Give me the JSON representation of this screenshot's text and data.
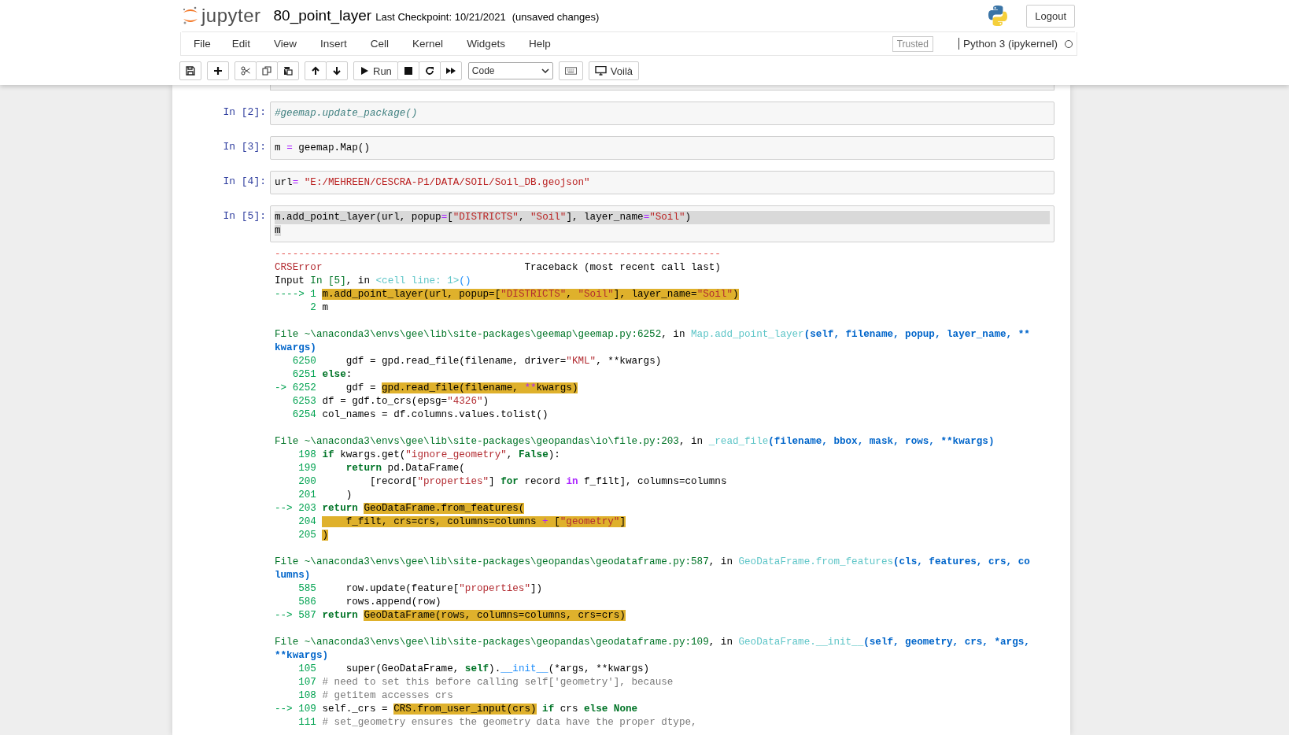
{
  "header": {
    "logo_text": "jupyter",
    "notebook_name": "80_point_layer",
    "checkpoint": "Last Checkpoint: 10/21/2021",
    "autosave_status": "(unsaved changes)",
    "logout_button": "Logout"
  },
  "menubar": {
    "items": [
      "File",
      "Edit",
      "View",
      "Insert",
      "Cell",
      "Kernel",
      "Widgets",
      "Help"
    ],
    "trusted_badge": "Trusted",
    "kernel_name": "Python 3 (ipykernel)",
    "kernel_busy": false
  },
  "toolbar": {
    "groups": [
      [
        {
          "kind": "save"
        }
      ],
      [
        {
          "kind": "insert"
        }
      ],
      [
        {
          "kind": "cut"
        },
        {
          "kind": "copy"
        },
        {
          "kind": "paste"
        }
      ],
      [
        {
          "kind": "move-up"
        },
        {
          "kind": "move-down"
        }
      ],
      [
        {
          "kind": "run",
          "label": "Run"
        },
        {
          "kind": "stop"
        },
        {
          "kind": "restart"
        },
        {
          "kind": "run-all"
        }
      ]
    ],
    "cell_type": "Code",
    "extra": [
      {
        "kind": "keyboard"
      },
      {
        "kind": "voila",
        "label": "Voilà"
      }
    ]
  },
  "cells": [
    {
      "prompt": "In [2]:",
      "lines": [
        {
          "selected": false,
          "tokens": [
            {
              "kind": "comment",
              "text": "#geemap.update_package()"
            }
          ]
        }
      ]
    },
    {
      "prompt": "In [3]:",
      "lines": [
        {
          "selected": false,
          "tokens": [
            {
              "kind": "plain",
              "text": "m "
            },
            {
              "kind": "operator",
              "text": "="
            },
            {
              "kind": "plain",
              "text": " geemap.Map()"
            }
          ]
        }
      ]
    },
    {
      "prompt": "In [4]:",
      "lines": [
        {
          "selected": false,
          "tokens": [
            {
              "kind": "plain",
              "text": "url"
            },
            {
              "kind": "operator",
              "text": "= "
            },
            {
              "kind": "string",
              "text": "\"E:/MEHREEN/CESCRA-P1/DATA/SOIL/Soil_DB.geojson\""
            }
          ]
        }
      ]
    },
    {
      "prompt": "In [5]:",
      "lines": [
        {
          "selected": true,
          "tokens": [
            {
              "kind": "plain",
              "text": "m.add_point_layer(url, popup"
            },
            {
              "kind": "operator",
              "text": "="
            },
            {
              "kind": "plain",
              "text": "["
            },
            {
              "kind": "string",
              "text": "\"DISTRICTS\""
            },
            {
              "kind": "plain",
              "text": ", "
            },
            {
              "kind": "string",
              "text": "\"Soil\""
            },
            {
              "kind": "plain",
              "text": "], layer_name"
            },
            {
              "kind": "operator",
              "text": "="
            },
            {
              "kind": "string",
              "text": "\"Soil\""
            },
            {
              "kind": "plain",
              "text": ")"
            }
          ]
        },
        {
          "selected": true,
          "tokens": [
            {
              "kind": "plain",
              "text": "m"
            }
          ]
        }
      ],
      "output": [
        {
          "gap_before": false,
          "tokens": [
            {
              "kind": "dash",
              "text": "---------------------------------------------------------------------------"
            }
          ]
        },
        {
          "gap_before": false,
          "tokens": [
            {
              "kind": "error",
              "text": "CRSError"
            },
            {
              "kind": "plain",
              "text": "                                  Traceback (most recent call last)"
            }
          ]
        },
        {
          "gap_before": false,
          "tokens": [
            {
              "kind": "plain",
              "text": "Input "
            },
            {
              "kind": "path",
              "text": "In [5]"
            },
            {
              "kind": "plain",
              "text": ", in "
            },
            {
              "kind": "func",
              "text": "<cell line: 1>"
            },
            {
              "kind": "call",
              "text": "()"
            }
          ]
        },
        {
          "gap_before": false,
          "tokens": [
            {
              "kind": "arrow",
              "text": "----> 1 "
            },
            {
              "kind": "mark",
              "text": "m.add_point_layer(url, popup=["
            },
            {
              "kind": "mark-string",
              "text": "\"DISTRICTS\""
            },
            {
              "kind": "mark",
              "text": ", "
            },
            {
              "kind": "mark-string",
              "text": "\"Soil\""
            },
            {
              "kind": "mark",
              "text": "], layer_name="
            },
            {
              "kind": "mark-string",
              "text": "\"Soil\""
            },
            {
              "kind": "mark",
              "text": ")"
            }
          ]
        },
        {
          "gap_before": false,
          "tokens": [
            {
              "kind": "lineno",
              "text": "      2 "
            },
            {
              "kind": "plain",
              "text": "m"
            }
          ]
        },
        {
          "gap_before": true,
          "tokens": [
            {
              "kind": "path",
              "text": "File ~\\anaconda3\\envs\\gee\\lib\\site-packages\\geemap\\geemap.py:6252"
            },
            {
              "kind": "plain",
              "text": ", in "
            },
            {
              "kind": "func",
              "text": "Map.add_point_layer"
            },
            {
              "kind": "args",
              "text": "(self, filename, popup, layer_name, **"
            }
          ]
        },
        {
          "gap_before": false,
          "tokens": [
            {
              "kind": "args",
              "text": "kwargs)"
            }
          ]
        },
        {
          "gap_before": false,
          "tokens": [
            {
              "kind": "lineno",
              "text": "   6250 "
            },
            {
              "kind": "plain",
              "text": "    gdf = gpd.read_file(filename, driver="
            },
            {
              "kind": "string",
              "text": "\"KML\""
            },
            {
              "kind": "plain",
              "text": ", **kwargs)"
            }
          ]
        },
        {
          "gap_before": false,
          "tokens": [
            {
              "kind": "lineno",
              "text": "   6251 "
            },
            {
              "kind": "keyword",
              "text": "else"
            },
            {
              "kind": "plain",
              "text": ":"
            }
          ]
        },
        {
          "gap_before": false,
          "tokens": [
            {
              "kind": "arrow",
              "text": "-> 6252 "
            },
            {
              "kind": "plain",
              "text": "    gdf = "
            },
            {
              "kind": "mark",
              "text": "gpd.read_file(filename, "
            },
            {
              "kind": "mark-operator",
              "text": "**"
            },
            {
              "kind": "mark",
              "text": "kwargs)"
            }
          ]
        },
        {
          "gap_before": false,
          "tokens": [
            {
              "kind": "lineno",
              "text": "   6253 "
            },
            {
              "kind": "plain",
              "text": "df = gdf.to_crs(epsg="
            },
            {
              "kind": "string",
              "text": "\"4326\""
            },
            {
              "kind": "plain",
              "text": ")"
            }
          ]
        },
        {
          "gap_before": false,
          "tokens": [
            {
              "kind": "lineno",
              "text": "   6254 "
            },
            {
              "kind": "plain",
              "text": "col_names = df.columns.values.tolist()"
            }
          ]
        },
        {
          "gap_before": true,
          "tokens": [
            {
              "kind": "path",
              "text": "File ~\\anaconda3\\envs\\gee\\lib\\site-packages\\geopandas\\io\\file.py:203"
            },
            {
              "kind": "plain",
              "text": ", in "
            },
            {
              "kind": "func",
              "text": "_read_file"
            },
            {
              "kind": "args",
              "text": "(filename, bbox, mask, rows, **kwargs)"
            }
          ]
        },
        {
          "gap_before": false,
          "tokens": [
            {
              "kind": "lineno",
              "text": "    198 "
            },
            {
              "kind": "keyword",
              "text": "if"
            },
            {
              "kind": "plain",
              "text": " kwargs.get("
            },
            {
              "kind": "string",
              "text": "\"ignore_geometry\""
            },
            {
              "kind": "plain",
              "text": ", "
            },
            {
              "kind": "keyword",
              "text": "False"
            },
            {
              "kind": "plain",
              "text": "):"
            }
          ]
        },
        {
          "gap_before": false,
          "tokens": [
            {
              "kind": "lineno",
              "text": "    199     "
            },
            {
              "kind": "keyword",
              "text": "return"
            },
            {
              "kind": "plain",
              "text": " pd.DataFrame("
            }
          ]
        },
        {
          "gap_before": false,
          "tokens": [
            {
              "kind": "lineno",
              "text": "    200 "
            },
            {
              "kind": "plain",
              "text": "        [record["
            },
            {
              "kind": "string",
              "text": "\"properties\""
            },
            {
              "kind": "plain",
              "text": "] "
            },
            {
              "kind": "keyword",
              "text": "for"
            },
            {
              "kind": "plain",
              "text": " record "
            },
            {
              "kind": "operator",
              "text": "in"
            },
            {
              "kind": "plain",
              "text": " f_filt], columns=columns"
            }
          ]
        },
        {
          "gap_before": false,
          "tokens": [
            {
              "kind": "lineno",
              "text": "    201 "
            },
            {
              "kind": "plain",
              "text": "    )"
            }
          ]
        },
        {
          "gap_before": false,
          "tokens": [
            {
              "kind": "arrow",
              "text": "--> 203 "
            },
            {
              "kind": "keyword",
              "text": "return "
            },
            {
              "kind": "mark",
              "text": "GeoDataFrame.from_features("
            }
          ]
        },
        {
          "gap_before": false,
          "tokens": [
            {
              "kind": "lineno",
              "text": "    204 "
            },
            {
              "kind": "mark",
              "text": "    f_filt, crs=crs, columns=columns "
            },
            {
              "kind": "mark-operator",
              "text": "+"
            },
            {
              "kind": "mark",
              "text": " ["
            },
            {
              "kind": "mark-string",
              "text": "\"geometry\""
            },
            {
              "kind": "mark",
              "text": "]"
            }
          ]
        },
        {
          "gap_before": false,
          "tokens": [
            {
              "kind": "lineno",
              "text": "    205 "
            },
            {
              "kind": "mark",
              "text": ")"
            }
          ]
        },
        {
          "gap_before": true,
          "tokens": [
            {
              "kind": "path",
              "text": "File ~\\anaconda3\\envs\\gee\\lib\\site-packages\\geopandas\\geodataframe.py:587"
            },
            {
              "kind": "plain",
              "text": ", in "
            },
            {
              "kind": "func",
              "text": "GeoDataFrame.from_features"
            },
            {
              "kind": "args",
              "text": "(cls, features, crs, co"
            }
          ]
        },
        {
          "gap_before": false,
          "tokens": [
            {
              "kind": "args",
              "text": "lumns)"
            }
          ]
        },
        {
          "gap_before": false,
          "tokens": [
            {
              "kind": "lineno",
              "text": "    585 "
            },
            {
              "kind": "plain",
              "text": "    row.update(feature["
            },
            {
              "kind": "string",
              "text": "\"properties\""
            },
            {
              "kind": "plain",
              "text": "])"
            }
          ]
        },
        {
          "gap_before": false,
          "tokens": [
            {
              "kind": "lineno",
              "text": "    586 "
            },
            {
              "kind": "plain",
              "text": "    rows.append(row)"
            }
          ]
        },
        {
          "gap_before": false,
          "tokens": [
            {
              "kind": "arrow",
              "text": "--> 587 "
            },
            {
              "kind": "keyword",
              "text": "return "
            },
            {
              "kind": "mark",
              "text": "GeoDataFrame(rows, columns=columns, crs=crs)"
            }
          ]
        },
        {
          "gap_before": true,
          "tokens": [
            {
              "kind": "path",
              "text": "File ~\\anaconda3\\envs\\gee\\lib\\site-packages\\geopandas\\geodataframe.py:109"
            },
            {
              "kind": "plain",
              "text": ", in "
            },
            {
              "kind": "func",
              "text": "GeoDataFrame.__init__"
            },
            {
              "kind": "args",
              "text": "(self, geometry, crs, *args,"
            }
          ]
        },
        {
          "gap_before": false,
          "tokens": [
            {
              "kind": "args",
              "text": "**kwargs)"
            }
          ]
        },
        {
          "gap_before": false,
          "tokens": [
            {
              "kind": "lineno",
              "text": "    105 "
            },
            {
              "kind": "plain",
              "text": "    super(GeoDataFrame, "
            },
            {
              "kind": "keyword",
              "text": "self"
            },
            {
              "kind": "plain",
              "text": ")."
            },
            {
              "kind": "call",
              "text": "__init__"
            },
            {
              "kind": "plain",
              "text": "(*args, **kwargs)"
            }
          ]
        },
        {
          "gap_before": false,
          "tokens": [
            {
              "kind": "lineno",
              "text": "    107 "
            },
            {
              "kind": "comment",
              "text": "# need to set this before calling self['geometry'], because"
            }
          ]
        },
        {
          "gap_before": false,
          "tokens": [
            {
              "kind": "lineno",
              "text": "    108 "
            },
            {
              "kind": "comment",
              "text": "# getitem accesses crs"
            }
          ]
        },
        {
          "gap_before": false,
          "tokens": [
            {
              "kind": "arrow",
              "text": "--> 109 "
            },
            {
              "kind": "plain",
              "text": "self._crs = "
            },
            {
              "kind": "mark",
              "text": "CRS.from_user_input(crs)"
            },
            {
              "kind": "keyword",
              "text": " if"
            },
            {
              "kind": "plain",
              "text": " crs "
            },
            {
              "kind": "keyword",
              "text": "else None"
            }
          ]
        },
        {
          "gap_before": false,
          "tokens": [
            {
              "kind": "lineno",
              "text": "    111 "
            },
            {
              "kind": "comment",
              "text": "# set_geometry ensures the geometry data have the proper dtype,"
            }
          ]
        }
      ]
    }
  ]
}
